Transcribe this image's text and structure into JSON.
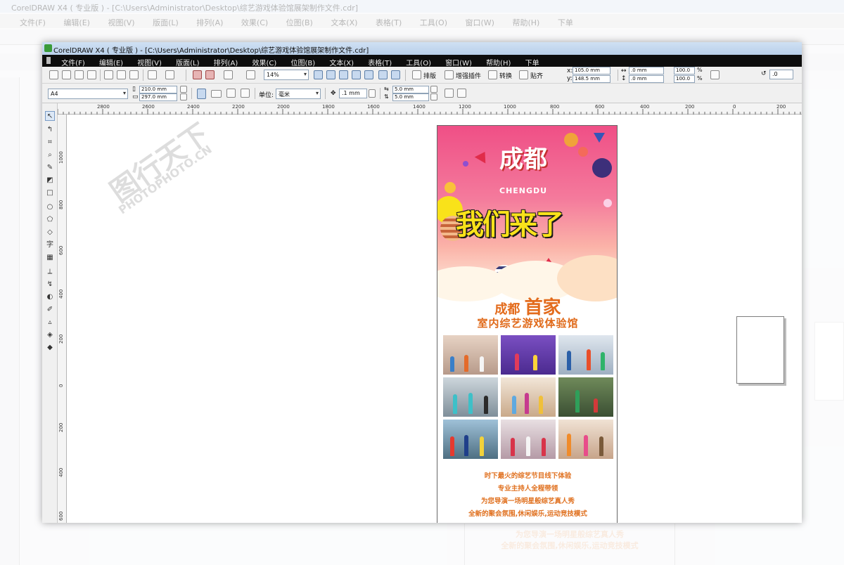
{
  "background_window": {
    "title": "CorelDRAW X4 ( 专业版 ) - [C:\\Users\\Administrator\\Desktop\\综艺游戏体验馆展架制作文件.cdr]",
    "menu": [
      "文件(F)",
      "编辑(E)",
      "视图(V)",
      "版面(L)",
      "排列(A)",
      "效果(C)",
      "位图(B)",
      "文本(X)",
      "表格(T)",
      "工具(O)",
      "窗口(W)",
      "帮助(H)",
      "下单"
    ]
  },
  "window": {
    "title": "CorelDRAW X4 ( 专业版 ) - [C:\\Users\\Administrator\\Desktop\\综艺游戏体验馆展架制作文件.cdr]",
    "menu": [
      "文件(F)",
      "编辑(E)",
      "视图(V)",
      "版面(L)",
      "排列(A)",
      "效果(C)",
      "位图(B)",
      "文本(X)",
      "表格(T)",
      "工具(O)",
      "窗口(W)",
      "帮助(H)",
      "下单"
    ]
  },
  "toolbar": {
    "zoom": "14%",
    "plugin_buttons": [
      "排版",
      "增强插件",
      "转换",
      "贴齐"
    ],
    "x": "105.0 mm",
    "y": "148.5 mm",
    "w": ".0 mm",
    "h": ".0 mm",
    "scale_w": "100.0",
    "scale_h": "100.0",
    "percent": "%",
    "angle": ".0"
  },
  "property_bar": {
    "page_size": "A4",
    "page_width": "210.0 mm",
    "page_height": "297.0 mm",
    "unit_label": "单位:",
    "unit": "毫米",
    "nudge": ".1 mm",
    "dup_x": "5.0 mm",
    "dup_y": "5.0 mm"
  },
  "ruler": {
    "top": [
      "2800",
      "2600",
      "2400",
      "2200",
      "2000",
      "1800",
      "1600",
      "1400",
      "1200",
      "1000",
      "800",
      "600",
      "400",
      "200",
      "0",
      "200"
    ],
    "left": [
      "1000",
      "800",
      "600",
      "400",
      "200",
      "0",
      "200",
      "400",
      "600"
    ]
  },
  "poster": {
    "city": "成都",
    "city_en": "CHENGDU",
    "headline": "我们来了",
    "sub_prefix": "成都",
    "sub_big": "首家",
    "sub_line2": "室内综艺游戏体验馆",
    "desc": [
      "时下最火的综艺节目线下体验",
      "专业主持人全程带领",
      "为您导演一场明星般综艺真人秀",
      "全新的聚会氛围,休闲娱乐,运动竞技模式"
    ]
  },
  "watermark": {
    "text_cn": "图行天下",
    "text_en": "PHOTOPHOTO.CN"
  },
  "colors": {
    "menubar": "#0d0d0d",
    "titlebar": "#c3d7ee",
    "poster_pink": "#ef4f86",
    "poster_orange_text": "#e36b1c",
    "headline_yellow": "#f9e21a"
  }
}
